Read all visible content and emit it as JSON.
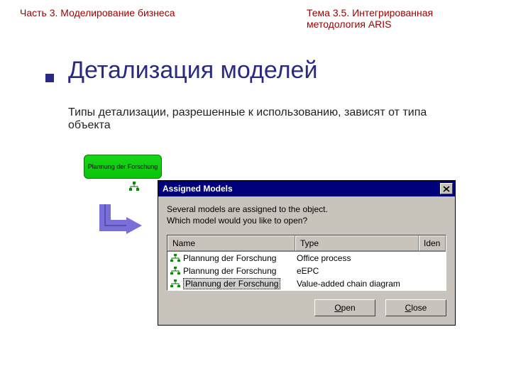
{
  "header": {
    "left": "Часть 3. Моделирование бизнеса",
    "right": "Тема 3.5. Интегрированная методология ARIS"
  },
  "title": "Детализация моделей",
  "subtitle": "Типы детализации, разрешенные к использованию, зависят от типа объекта",
  "process_box_label": "Plannung der Forschung",
  "dialog": {
    "title": "Assigned Models",
    "message_line1": "Several models are assigned to the object.",
    "message_line2": "Which model would you like to open?",
    "columns": {
      "name": "Name",
      "type": "Type",
      "iden": "Iden"
    },
    "rows": [
      {
        "name": "Plannung der Forschung",
        "type": "Office process"
      },
      {
        "name": "Plannung der Forschung",
        "type": "eEPC"
      },
      {
        "name": "Plannung der Forschung",
        "type": "Value-added chain diagram"
      }
    ],
    "buttons": {
      "open_u": "O",
      "open_rest": "pen",
      "close_u": "C",
      "close_rest": "lose"
    }
  }
}
